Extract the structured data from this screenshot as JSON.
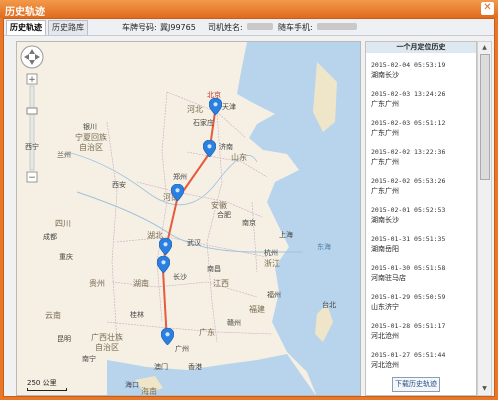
{
  "window": {
    "title": "历史轨迹",
    "close_glyph": "✕"
  },
  "tabs": [
    {
      "label": "历史轨迹",
      "active": true
    },
    {
      "label": "历史路库",
      "active": false
    }
  ],
  "info": {
    "plate_label": "车牌号码:",
    "plate_value": "冀J99765",
    "driver_label": "司机姓名:",
    "phone_label": "随车手机:"
  },
  "map": {
    "capital_label": "北京",
    "labels": [
      "天津",
      "河北",
      "石家庄",
      "济南",
      "山东",
      "宁夏回族",
      "自治区",
      "银川",
      "兰州",
      "西宁",
      "郑州",
      "西安",
      "河南",
      "合肥",
      "安徽",
      "南京",
      "上海",
      "湖北",
      "武汉",
      "杭州",
      "浙江",
      "重庆",
      "长沙",
      "江西",
      "南昌",
      "贵州",
      "湖南",
      "福州",
      "福建",
      "桂林",
      "南宁",
      "广西壮族",
      "自治区",
      "广东",
      "广州",
      "澳门",
      "香港",
      "台北",
      "海口",
      "海南",
      "昆明",
      "云南",
      "四川",
      "成都",
      "赣州",
      "东海"
    ],
    "scale_label": "250 公里",
    "route_color": "#e65a3e",
    "pin_color": "#2a7fe0"
  },
  "history": {
    "header": "一个月定位历史",
    "records": [
      {
        "datetime": "2015-02-04 05:53:19",
        "place": "湖南长沙"
      },
      {
        "datetime": "2015-02-03 13:24:26",
        "place": "广东广州"
      },
      {
        "datetime": "2015-02-03 05:51:12",
        "place": "广东广州"
      },
      {
        "datetime": "2015-02-02 13:22:36",
        "place": "广东广州"
      },
      {
        "datetime": "2015-02-02 05:53:26",
        "place": "广东广州"
      },
      {
        "datetime": "2015-02-01 05:52:53",
        "place": "湖南长沙"
      },
      {
        "datetime": "2015-01-31 05:51:35",
        "place": "湖南岳阳"
      },
      {
        "datetime": "2015-01-30 05:51:58",
        "place": "河南驻马店"
      },
      {
        "datetime": "2015-01-29 05:50:59",
        "place": "山东济宁"
      },
      {
        "datetime": "2015-01-28 05:51:17",
        "place": "河北沧州"
      },
      {
        "datetime": "2015-01-27 05:51:44",
        "place": "河北沧州"
      }
    ],
    "download_label": "下载历史轨迹"
  }
}
